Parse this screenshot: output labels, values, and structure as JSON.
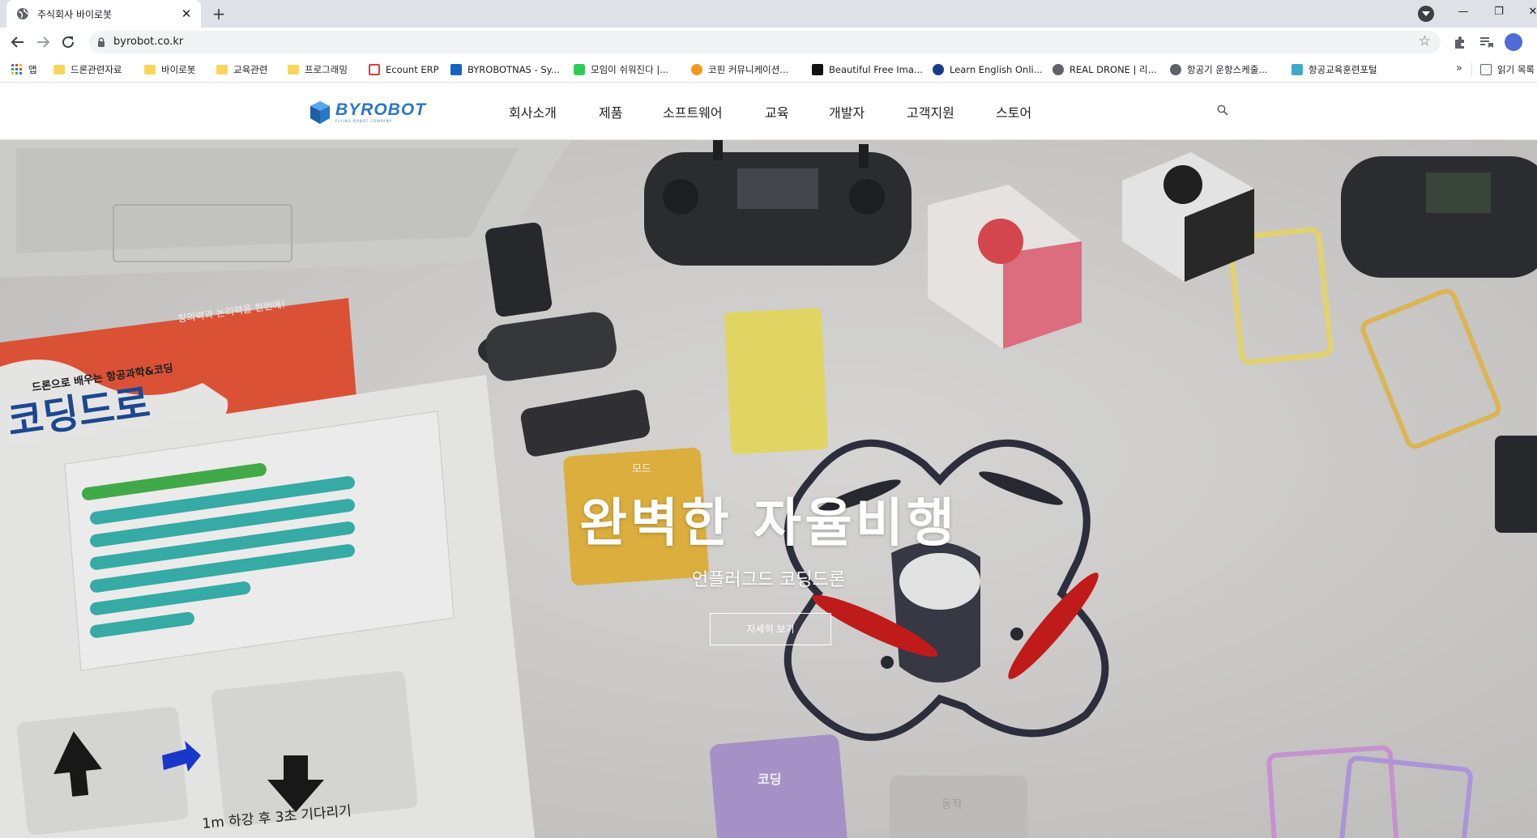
{
  "browser": {
    "tab_title": "주식회사 바이로봇",
    "url": "byrobot.co.kr",
    "bookmarks": [
      {
        "label": "앱",
        "icon": "apps-grid-icon"
      },
      {
        "label": "드론관련자료",
        "icon": "folder-icon"
      },
      {
        "label": "바이로봇",
        "icon": "folder-icon"
      },
      {
        "label": "교육관련",
        "icon": "folder-icon"
      },
      {
        "label": "프로그래밍",
        "icon": "folder-icon"
      },
      {
        "label": "Ecount ERP",
        "icon": "ecount-icon"
      },
      {
        "label": "BYROBOTNAS - Sy...",
        "icon": "dsm-icon"
      },
      {
        "label": "모임이 쉬워진다 |...",
        "icon": "band-icon"
      },
      {
        "label": "코핀 커뮤니케이션...",
        "icon": "korean-site-icon"
      },
      {
        "label": "Beautiful Free Ima...",
        "icon": "unsplash-icon"
      },
      {
        "label": "Learn English Onli...",
        "icon": "globe-blue-icon"
      },
      {
        "label": "REAL DRONE | 리...",
        "icon": "globe-icon"
      },
      {
        "label": "항공기 운항스케줄...",
        "icon": "globe-icon"
      },
      {
        "label": "항공교육훈련포털",
        "icon": "plane-icon"
      }
    ],
    "reading_list_label": "읽기 목록",
    "more_bookmarks": "»"
  },
  "site": {
    "logo_text": "BYROBOT",
    "logo_subtext": "FLYING ROBOT COMPANY",
    "menu": [
      "회사소개",
      "제품",
      "소프트웨어",
      "교육",
      "개발자",
      "고객지원",
      "스토어"
    ]
  },
  "hero": {
    "title": "완벽한 자율비행",
    "subtitle": "언플러그드 코딩드론",
    "button_label": "자세히 보기",
    "book_title": "코딩드로",
    "book_subtitle": "드론으로 배우는 항공과학&코딩",
    "book_top_text": "창의력과 논리력을 한번에!",
    "book_caption": "1m 하강 후 3초 기다리기",
    "card_labels": [
      "코딩",
      "동작",
      "모드"
    ]
  }
}
